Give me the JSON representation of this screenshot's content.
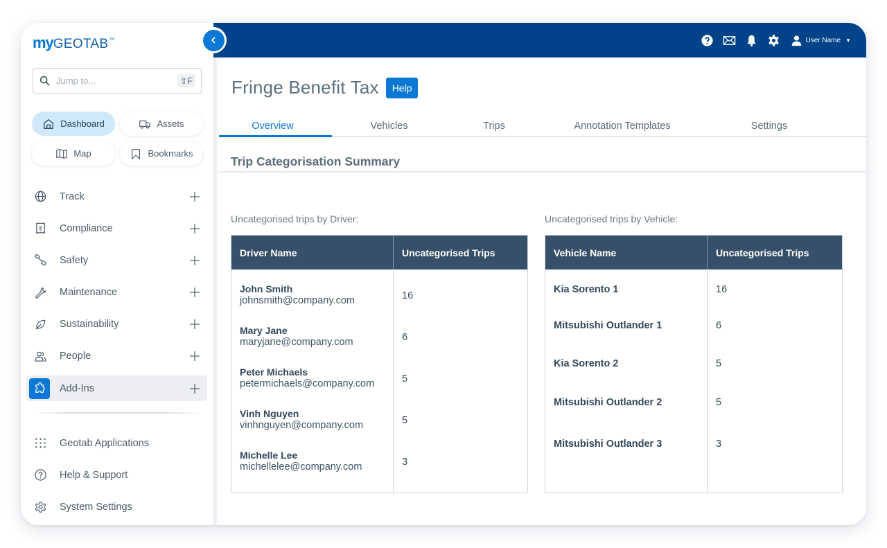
{
  "app": {
    "logo_prefix": "my",
    "logo_brand": "GEOTAB",
    "logo_tm": "™"
  },
  "search": {
    "placeholder": "Jump to...",
    "shortcut": "⇧F"
  },
  "quick_links": [
    {
      "label": "Dashboard",
      "icon": "home-icon",
      "active": true
    },
    {
      "label": "Assets",
      "icon": "truck-icon",
      "active": false
    },
    {
      "label": "Map",
      "icon": "map-icon",
      "active": false
    },
    {
      "label": "Bookmarks",
      "icon": "bookmark-icon",
      "active": false
    }
  ],
  "sidebar": {
    "items": [
      {
        "label": "Track",
        "icon": "globe-icon"
      },
      {
        "label": "Compliance",
        "icon": "receipt-check-icon"
      },
      {
        "label": "Safety",
        "icon": "seatbelt-icon"
      },
      {
        "label": "Maintenance",
        "icon": "wrench-icon"
      },
      {
        "label": "Sustainability",
        "icon": "leaf-icon"
      },
      {
        "label": "People",
        "icon": "people-icon"
      },
      {
        "label": "Add-Ins",
        "icon": "puzzle-icon",
        "active": true
      }
    ],
    "bottom_items": [
      {
        "label": "Geotab Applications",
        "icon": "grid-dots-icon"
      },
      {
        "label": "Help & Support",
        "icon": "help-circle-icon"
      },
      {
        "label": "System Settings",
        "icon": "gear-icon"
      }
    ]
  },
  "topbar": {
    "user_name": "User Name",
    "icons": [
      "help-icon",
      "mail-icon",
      "bell-icon",
      "gear-icon",
      "user-icon"
    ]
  },
  "page": {
    "title": "Fringe Benefit Tax",
    "help_label": "Help",
    "tabs": [
      {
        "label": "Overview",
        "active": true
      },
      {
        "label": "Vehicles"
      },
      {
        "label": "Trips"
      },
      {
        "label": "Annotation Templates"
      },
      {
        "label": "Settings"
      }
    ],
    "section_title": "Trip Categorisation Summary"
  },
  "driver_table": {
    "caption": "Uncategorised trips by Driver:",
    "headers": [
      "Driver Name",
      "Uncategorised Trips"
    ],
    "rows": [
      {
        "name": "John Smith",
        "email": "johnsmith@company.com",
        "trips": "16"
      },
      {
        "name": "Mary Jane",
        "email": "maryjane@company.com",
        "trips": "6"
      },
      {
        "name": "Peter Michaels",
        "email": "petermichaels@company.com",
        "trips": "5"
      },
      {
        "name": "Vinh Nguyen",
        "email": "vinhnguyen@company.com",
        "trips": "5"
      },
      {
        "name": "Michelle Lee",
        "email": "michellelee@company.com",
        "trips": "3"
      }
    ]
  },
  "vehicle_table": {
    "caption": "Uncategorised trips by Vehicle:",
    "headers": [
      "Vehicle Name",
      "Uncategorised Trips"
    ],
    "rows": [
      {
        "name": "Kia Sorento 1",
        "trips": "16"
      },
      {
        "name": "Mitsubishi Outlander 1",
        "trips": "6"
      },
      {
        "name": "Kia Sorento 2",
        "trips": "5"
      },
      {
        "name": "Mitsubishi Outlander 2",
        "trips": "5"
      },
      {
        "name": "Mitsubishi Outlander 3",
        "trips": "3"
      }
    ]
  },
  "colors": {
    "brand_blue": "#0b78d6",
    "topbar_navy": "#004388",
    "table_header": "#37506a",
    "active_quick_link": "#cfe9fb"
  }
}
